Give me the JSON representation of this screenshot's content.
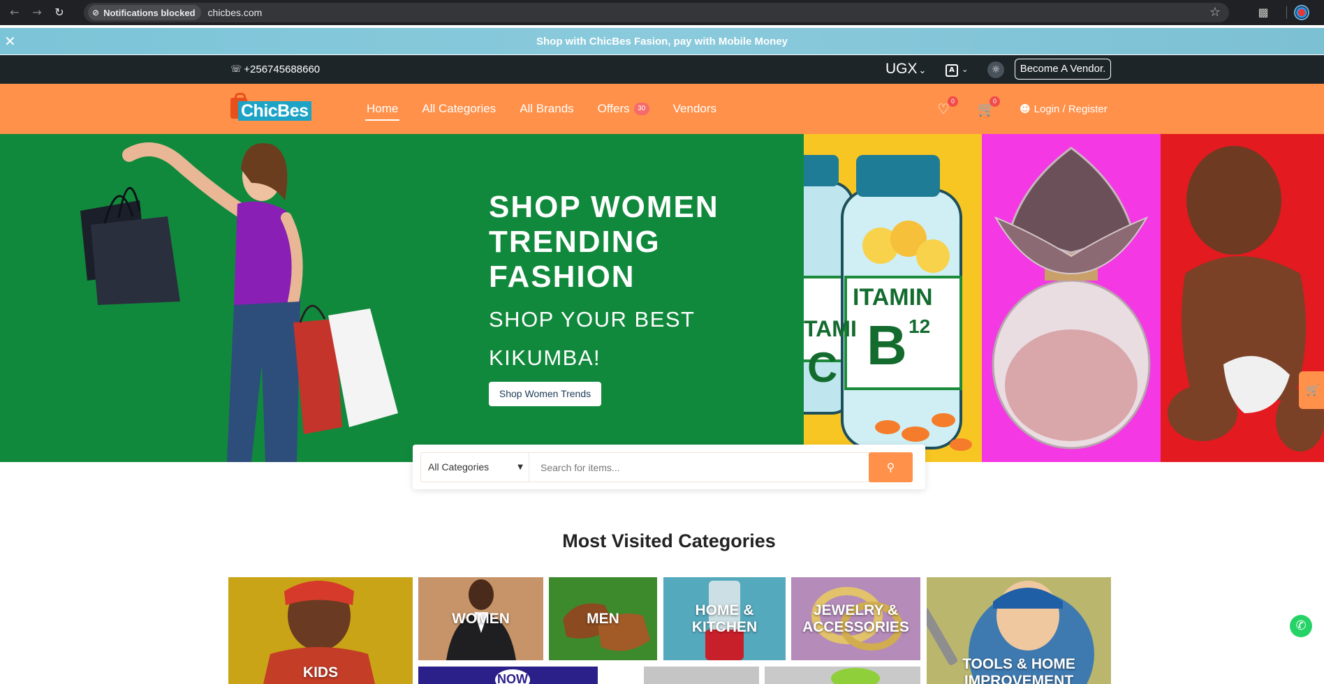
{
  "browser": {
    "notification_chip": "Notifications blocked",
    "url": "chicbes.com"
  },
  "promo": {
    "text": "Shop with ChicBes Fasion, pay with Mobile Money"
  },
  "topbar": {
    "phone": "+256745688660",
    "currency": "UGX",
    "vendor_button": "Become A Vendor."
  },
  "nav": {
    "logo": "ChicBes",
    "links": [
      "Home",
      "All Categories",
      "All Brands",
      "Offers",
      "Vendors"
    ],
    "offers_badge": "30",
    "wishlist_count": "0",
    "cart_count": "0",
    "login": "Login / Register"
  },
  "hero": {
    "title": "SHOP WOMEN TRENDING FASHION",
    "subtitle": "SHOP YOUR BEST KIKUMBA!",
    "button": "Shop Women Trends",
    "panel_texts": {
      "vit_left": "TAMI",
      "vit_c": "C",
      "vit_right": "ITAMIN",
      "vit_b": "B",
      "vit_12": "12"
    }
  },
  "search": {
    "category": "All Categories",
    "placeholder": "Search for items..."
  },
  "categories": {
    "title": "Most Visited Categories",
    "tiles": [
      "KIDS",
      "WOMEN",
      "MEN",
      "HOME & KITCHEN",
      "JEWELRY & ACCESSORIES",
      "TOOLS & HOME IMPROVEMENT"
    ],
    "bottom_tile_text": "NOW"
  },
  "colors": {
    "accent": "#ff914a",
    "hero_green": "#11893c",
    "topbar": "#1e2529",
    "promo": "#8acadc"
  }
}
